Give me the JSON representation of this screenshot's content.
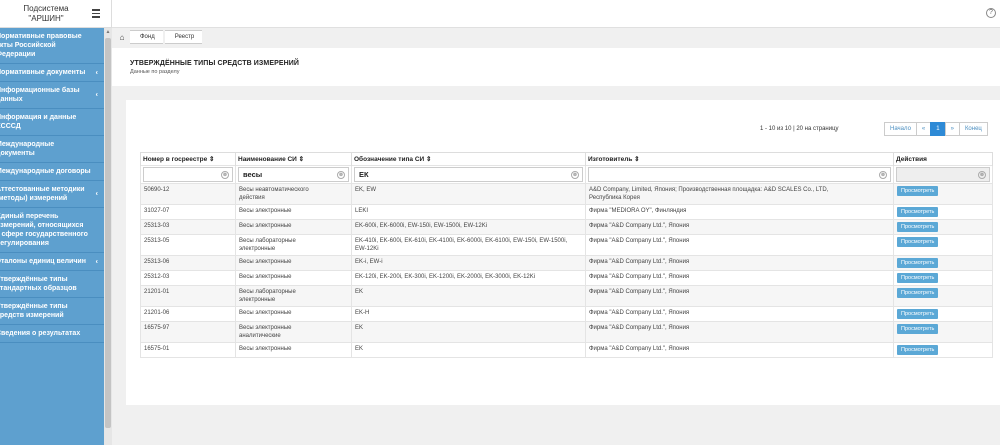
{
  "sidebar": {
    "title": "Подсистема \"АРШИН\"",
    "menu": [
      {
        "label": "Нормативные правовые\nакты Российской\nФедерации",
        "chevron": ""
      },
      {
        "label": "Нормативные документы",
        "chevron": "‹"
      },
      {
        "label": "Информационные базы\nданных",
        "chevron": "‹"
      },
      {
        "label": "Информация и данные\nЕСССД",
        "chevron": ""
      },
      {
        "label": "Международные\nдокументы",
        "chevron": ""
      },
      {
        "label": "Международные договоры",
        "chevron": ""
      },
      {
        "label": "Аттестованные методики\n(методы) измерений",
        "chevron": "‹"
      },
      {
        "label": "Единый перечень\nизмерений, относящихся\nк сфере государственного\nрегулирования",
        "chevron": ""
      },
      {
        "label": "Эталоны единиц величин",
        "chevron": "‹"
      },
      {
        "label": "Утверждённые типы\nстандартных образцов",
        "chevron": ""
      },
      {
        "label": "Утверждённые типы\nсредств измерений",
        "chevron": ""
      },
      {
        "label": "Сведения о результатах",
        "chevron": ""
      }
    ]
  },
  "topbar": {
    "help": "?"
  },
  "breadcrumb": {
    "home": "⌂",
    "items": [
      "Фонд",
      "Реестр"
    ]
  },
  "header": {
    "title": "УТВЕРЖДЁННЫЕ ТИПЫ СРЕДСТВ ИЗМЕРЕНИЙ",
    "subtitle": "Данные по разделу"
  },
  "pagination": {
    "info": "1 - 10 из 10 | 20 на страницу",
    "first": "Начало",
    "prev": "«",
    "current": "1",
    "next": "»",
    "last": "Конец"
  },
  "table": {
    "headers": [
      "Номер в госреестре ⇕",
      "Наименование СИ ⇕",
      "Обозначение типа СИ ⇕",
      "Изготовитель ⇕",
      "Действия"
    ],
    "filters": [
      "",
      "весы",
      "ЕК",
      "",
      ""
    ],
    "clear": "⊗",
    "action_label": "Просмотреть",
    "rows": [
      [
        "50690-12",
        "Весы неавтоматического\nдействия",
        "EK, EW",
        "A&D Company, Limited, Япония; Производственная площадка: A&D SCALES Co., LTD,\nРеспублика Корея"
      ],
      [
        "31027-07",
        "Весы электронные",
        "LEKI",
        "Фирма \"MEDIORA OY\", Финляндия"
      ],
      [
        "25313-03",
        "Весы электронные",
        "EK-600i, EK-6000i, EW-150i, EW-1500i, EW-12Ki",
        "Фирма \"A&D Company Ltd.\", Япония"
      ],
      [
        "25313-05",
        "Весы лабораторные\nэлектронные",
        "EK-410i, EK-600i, EK-610i, EK-4100i, EK-6000i, EK-6100i, EW-150i, EW-1500i,\nEW-12Ki",
        "Фирма \"A&D Company Ltd.\", Япония"
      ],
      [
        "25313-06",
        "Весы электронные",
        "EK-i, EW-i",
        "Фирма \"A&D Company Ltd.\", Япония"
      ],
      [
        "25312-03",
        "Весы электронные",
        "EK-120i, EK-200i, EK-300i, EK-1200i, EK-2000i, EK-3000i, EK-12Ki",
        "Фирма \"A&D Company Ltd.\", Япония"
      ],
      [
        "21201-01",
        "Весы лабораторные\nэлектронные",
        "EK",
        "Фирма \"A&D Company Ltd.\", Япония"
      ],
      [
        "21201-06",
        "Весы электронные",
        "EK-H",
        "Фирма \"A&D Company Ltd.\", Япония"
      ],
      [
        "16575-97",
        "Весы электронные\nаналитические",
        "EK",
        "Фирма \"A&D Company Ltd.\", Япония"
      ],
      [
        "16575-01",
        "Весы электронные",
        "EK",
        "Фирма \"A&D Company Ltd.\", Япония"
      ]
    ]
  }
}
